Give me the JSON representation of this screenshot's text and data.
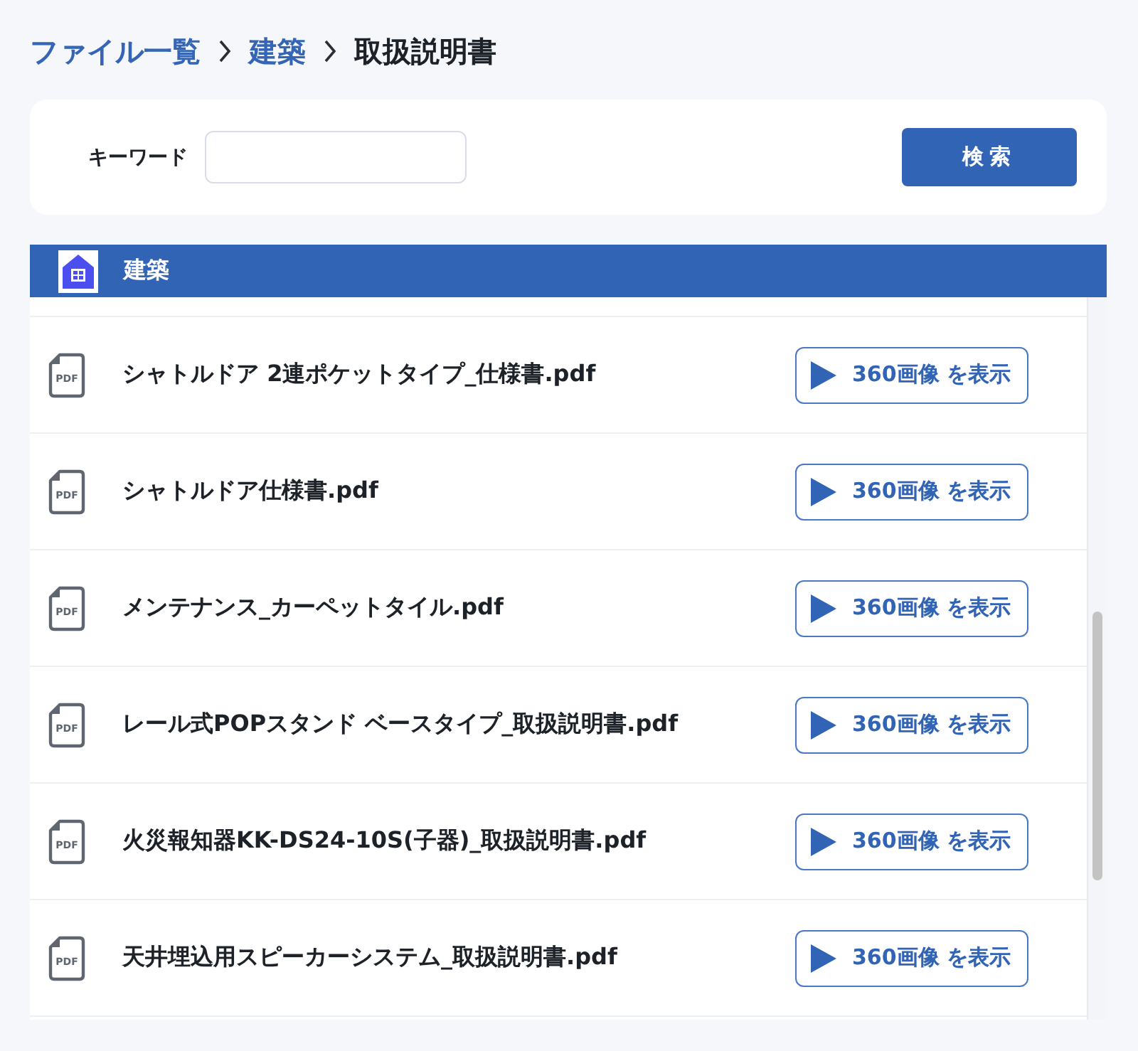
{
  "breadcrumb": [
    {
      "label": "ファイル一覧",
      "kind": "link"
    },
    {
      "label": "建築",
      "kind": "link"
    },
    {
      "label": "取扱説明書",
      "kind": "current"
    }
  ],
  "search": {
    "label": "キーワード",
    "button": "検索"
  },
  "category": {
    "title": "建築"
  },
  "files": [
    {
      "name": "シャトルドア 2連ポケットタイプ_仕様書.pdf",
      "type_label": "PDF",
      "action": "360画像 を表示"
    },
    {
      "name": "シャトルドア仕様書.pdf",
      "type_label": "PDF",
      "action": "360画像 を表示"
    },
    {
      "name": "メンテナンス_カーペットタイル.pdf",
      "type_label": "PDF",
      "action": "360画像 を表示"
    },
    {
      "name": "レール式POPスタンド ベースタイプ_取扱説明書.pdf",
      "type_label": "PDF",
      "action": "360画像 を表示"
    },
    {
      "name": "火災報知器KK-DS24-10S(子器)_取扱説明書.pdf",
      "type_label": "PDF",
      "action": "360画像 を表示"
    },
    {
      "name": "天井埋込用スピーカーシステム_取扱説明書.pdf",
      "type_label": "PDF",
      "action": "360画像 を表示"
    }
  ]
}
